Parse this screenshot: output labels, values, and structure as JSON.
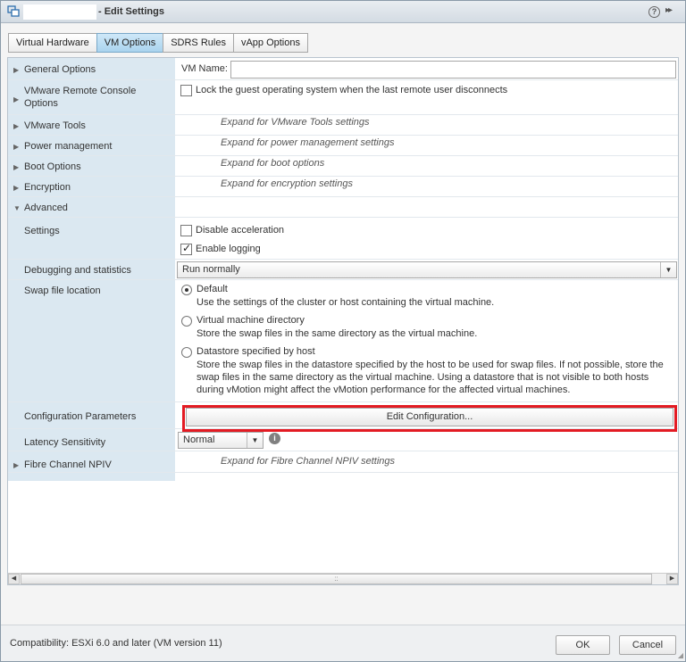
{
  "window": {
    "title": "- Edit Settings",
    "help_glyph": "?",
    "expand_glyph": "▸▸"
  },
  "tabs": [
    {
      "label": "Virtual Hardware",
      "active": false
    },
    {
      "label": "VM Options",
      "active": true
    },
    {
      "label": "SDRS Rules",
      "active": false
    },
    {
      "label": "vApp Options",
      "active": false
    }
  ],
  "rows": {
    "general": {
      "label": "General Options",
      "field_label": "VM Name:",
      "field_value": ""
    },
    "vmrc": {
      "label_line1": "VMware Remote Console",
      "label_line2": "Options",
      "checkbox_label": "Lock the guest operating system when the last remote user disconnects",
      "checked": false
    },
    "tools": {
      "label": "VMware Tools",
      "hint": "Expand for VMware Tools settings"
    },
    "power": {
      "label": "Power management",
      "hint": "Expand for power management settings"
    },
    "boot": {
      "label": "Boot Options",
      "hint": "Expand for boot options"
    },
    "encryption": {
      "label": "Encryption",
      "hint": "Expand for encryption settings"
    },
    "advanced": {
      "label": "Advanced"
    },
    "settings": {
      "label": "Settings",
      "disable_accel": {
        "label": "Disable acceleration",
        "checked": false
      },
      "enable_logging": {
        "label": "Enable logging",
        "checked": true
      }
    },
    "debug": {
      "label": "Debugging and statistics",
      "selected": "Run normally"
    },
    "swap": {
      "label": "Swap file location",
      "options": [
        {
          "title": "Default",
          "desc": [
            "Use the settings of the cluster or host containing the virtual machine."
          ],
          "selected": true
        },
        {
          "title": "Virtual machine directory",
          "desc": [
            "Store the swap files in the same directory as the virtual machine."
          ],
          "selected": false
        },
        {
          "title": "Datastore specified by host",
          "desc": [
            "Store the swap files in the datastore specified by the host to be used for swap files. If not possible, store the",
            "swap files in the same directory as the virtual machine. Using a datastore that is not visible to both hosts",
            "during vMotion might affect the vMotion performance for the affected virtual machines."
          ],
          "selected": false
        }
      ]
    },
    "config": {
      "label": "Configuration Parameters",
      "button": "Edit Configuration..."
    },
    "latency": {
      "label": "Latency Sensitivity",
      "selected": "Normal",
      "info_glyph": "i"
    },
    "fibre": {
      "label": "Fibre Channel NPIV",
      "hint": "Expand for Fibre Channel NPIV settings"
    }
  },
  "scroll": {
    "left": "◀",
    "right": "▶",
    "grip": "::"
  },
  "footer": {
    "compatibility": "Compatibility: ESXi 6.0 and later (VM version 11)",
    "ok": "OK",
    "cancel": "Cancel"
  },
  "colors": {
    "highlight": "#e31b23",
    "active_tab": "#a9d3ee",
    "label_column": "#dbe8f1"
  }
}
